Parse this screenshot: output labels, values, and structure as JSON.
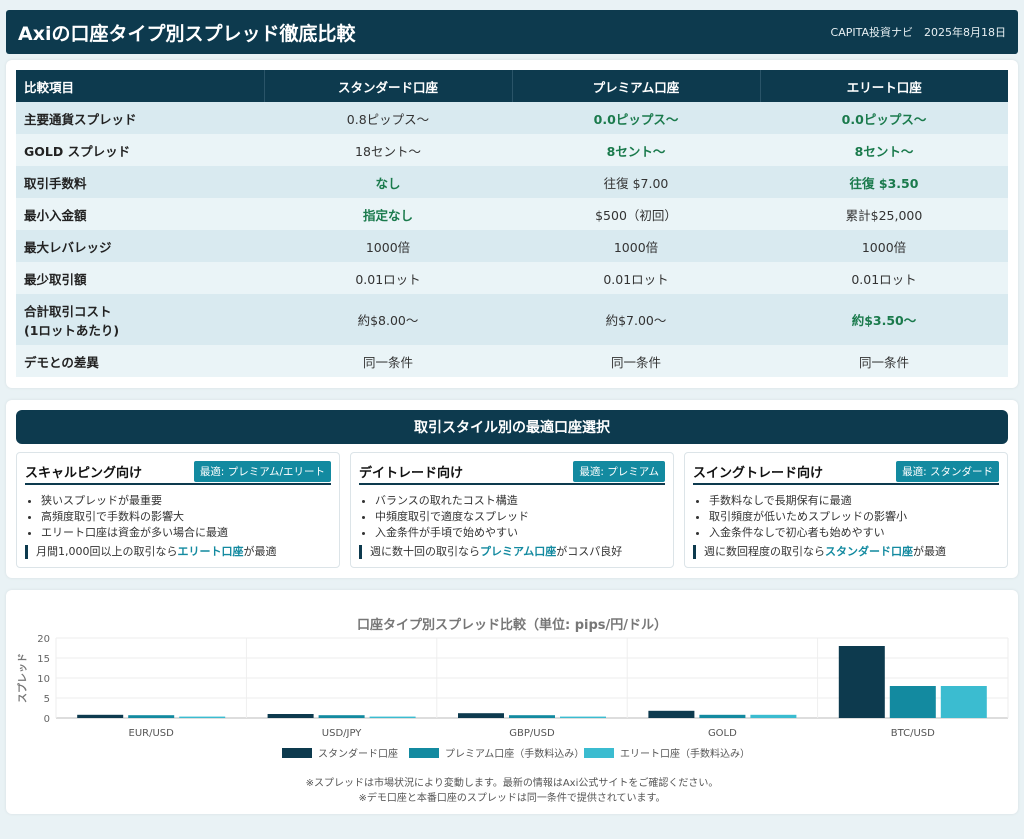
{
  "header": {
    "title": "Axiの口座タイプ別スプレッド徹底比較",
    "meta": "CAPITA投資ナビ　2025年8月18日"
  },
  "table": {
    "columns": [
      "比較項目",
      "スタンダード口座",
      "プレミアム口座",
      "エリート口座"
    ],
    "rows": [
      {
        "label": "主要通貨スプレッド",
        "cells": [
          "0.8ピップス〜",
          "0.0ピップス〜",
          "0.0ピップス〜"
        ],
        "highlight": [
          false,
          true,
          true
        ]
      },
      {
        "label": "GOLD スプレッド",
        "cells": [
          "18セント〜",
          "8セント〜",
          "8セント〜"
        ],
        "highlight": [
          false,
          true,
          true
        ]
      },
      {
        "label": "取引手数料",
        "cells": [
          "なし",
          "往復 $7.00",
          "往復 $3.50"
        ],
        "highlight": [
          true,
          false,
          true
        ]
      },
      {
        "label": "最小入金額",
        "cells": [
          "指定なし",
          "$500（初回）",
          "累計$25,000"
        ],
        "highlight": [
          true,
          false,
          false
        ]
      },
      {
        "label": "最大レバレッジ",
        "cells": [
          "1000倍",
          "1000倍",
          "1000倍"
        ],
        "highlight": [
          false,
          false,
          false
        ]
      },
      {
        "label": "最少取引額",
        "cells": [
          "0.01ロット",
          "0.01ロット",
          "0.01ロット"
        ],
        "highlight": [
          false,
          false,
          false
        ]
      },
      {
        "label": "合計取引コスト",
        "label2": "(1ロットあたり)",
        "cells": [
          "約$8.00〜",
          "約$7.00〜",
          "約$3.50〜"
        ],
        "highlight": [
          false,
          false,
          true
        ]
      },
      {
        "label": "デモとの差異",
        "cells": [
          "同一条件",
          "同一条件",
          "同一条件"
        ],
        "highlight": [
          false,
          false,
          false
        ]
      }
    ]
  },
  "styles": {
    "title": "取引スタイル別の最適口座選択",
    "cards": [
      {
        "name": "スキャルピング向け",
        "badge": "最適: プレミアム/エリート",
        "bullets": [
          "狭いスプレッドが最重要",
          "高頻度取引で手数料の影響大",
          "エリート口座は資金が多い場合に最適"
        ],
        "note_pre": "月間1,000回以上の取引なら",
        "note_em": "エリート口座",
        "note_post": "が最適"
      },
      {
        "name": "デイトレード向け",
        "badge": "最適: プレミアム",
        "bullets": [
          "バランスの取れたコスト構造",
          "中頻度取引で適度なスプレッド",
          "入金条件が手頃で始めやすい"
        ],
        "note_pre": "週に数十回の取引なら",
        "note_em": "プレミアム口座",
        "note_post": "がコスパ良好"
      },
      {
        "name": "スイングトレード向け",
        "badge": "最適: スタンダード",
        "bullets": [
          "手数料なしで長期保有に最適",
          "取引頻度が低いためスプレッドの影響小",
          "入金条件なしで初心者も始めやすい"
        ],
        "note_pre": "週に数回程度の取引なら",
        "note_em": "スタンダード口座",
        "note_post": "が最適"
      }
    ]
  },
  "chart_data": {
    "type": "bar",
    "title": "口座タイプ別スプレッド比較（単位: pips/円/ドル）",
    "ylabel": "スプレッド",
    "xlabel": "",
    "ylim": [
      0,
      20
    ],
    "yticks": [
      0,
      5,
      10,
      15,
      20
    ],
    "categories": [
      "EUR/USD",
      "USD/JPY",
      "GBP/USD",
      "GOLD",
      "BTC/USD"
    ],
    "series": [
      {
        "name": "スタンダード口座",
        "color": "#0d3a4e",
        "values": [
          0.8,
          1.0,
          1.2,
          1.8,
          18
        ]
      },
      {
        "name": "プレミアム口座（手数料込み）",
        "color": "#138aa0",
        "values": [
          0.7,
          0.7,
          0.7,
          0.8,
          8
        ]
      },
      {
        "name": "エリート口座（手数料込み）",
        "color": "#3bbcd0",
        "values": [
          0.35,
          0.35,
          0.35,
          0.8,
          8
        ]
      }
    ],
    "legend": "bottom",
    "grid": true
  },
  "notes": [
    "※スプレッドは市場状況により変動します。最新の情報はAxi公式サイトをご確認ください。",
    "※デモ口座と本番口座のスプレッドは同一条件で提供されています。"
  ]
}
